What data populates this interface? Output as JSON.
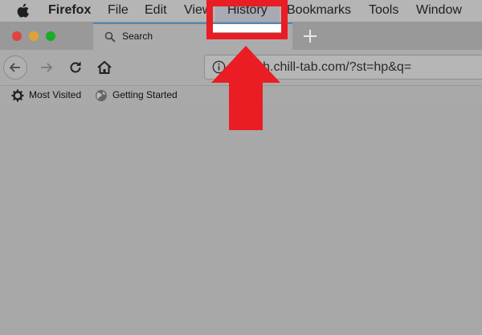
{
  "menubar": {
    "apple_icon": "apple-logo-icon",
    "app_name": "Firefox",
    "items": [
      "File",
      "Edit",
      "View",
      "History",
      "Bookmarks",
      "Tools",
      "Window"
    ]
  },
  "window": {
    "traffic_lights": {
      "close_color": "#e0443e",
      "minimize_color": "#dea236",
      "zoom_color": "#1aab29"
    }
  },
  "tab": {
    "label": "Search",
    "icon": "search-icon",
    "accent_color": "#4f86b5"
  },
  "toolbar": {
    "back_icon": "back-arrow-icon",
    "forward_icon": "forward-arrow-icon",
    "reload_icon": "reload-icon",
    "home_icon": "home-icon",
    "new_tab_icon": "plus-icon"
  },
  "urlbar": {
    "value": "search.chill-tab.com/?st=hp&q=",
    "info_icon": "info-icon"
  },
  "bookmarks": [
    {
      "label": "Most Visited",
      "icon": "gear-icon"
    },
    {
      "label": "Getting Started",
      "icon": "globe-icon"
    }
  ],
  "annotation": {
    "highlight_color": "#ea1c24",
    "target": "History"
  }
}
